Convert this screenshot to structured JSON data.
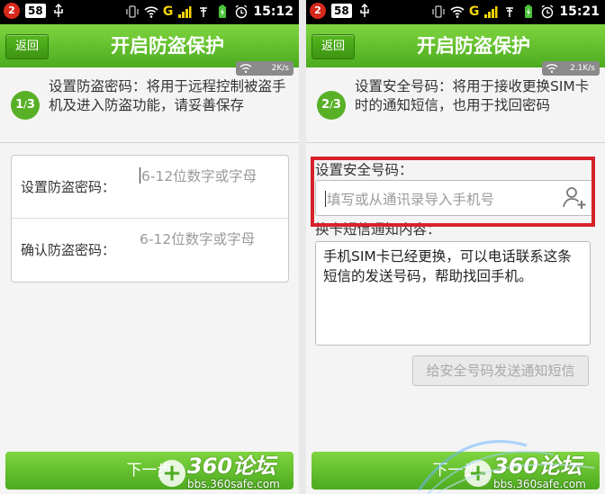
{
  "status_bar": {
    "notification_count": "2",
    "app_badge": "58",
    "signal_label": "G",
    "time_left": "15:12",
    "time_right": "15:21"
  },
  "header": {
    "back_label": "返回",
    "title": "开启防盗保护"
  },
  "left": {
    "speed": "2K/s",
    "step_current": "1",
    "step_total": "3",
    "step_text": "设置防盗密码：将用于远程控制被盗手机及进入防盗功能，请妥善保存",
    "password_label": "设置防盗密码：",
    "password_placeholder": "6-12位数字或字母",
    "confirm_label": "确认防盗密码：",
    "confirm_placeholder": "6-12位数字或字母"
  },
  "right": {
    "speed": "2.1K/s",
    "step_current": "2",
    "step_total": "3",
    "step_text": "设置安全号码：将用于接收更换SIM卡时的通知短信，也用于找回密码",
    "safe_number_label": "设置安全号码：",
    "phone_placeholder": "填写或从通讯录导入手机号",
    "sms_label": "换卡短信通知内容：",
    "sms_content": "手机SIM卡已经更换，可以电话联系这条短信的发送号码，帮助找回手机。",
    "notify_button": "给安全号码发送通知短信"
  },
  "next_button": "下一步",
  "watermark": {
    "brand": "360论坛",
    "url": "bbs.360safe.com"
  },
  "colors": {
    "accent_green": "#4bab1f",
    "highlight_red": "#d6222a"
  }
}
